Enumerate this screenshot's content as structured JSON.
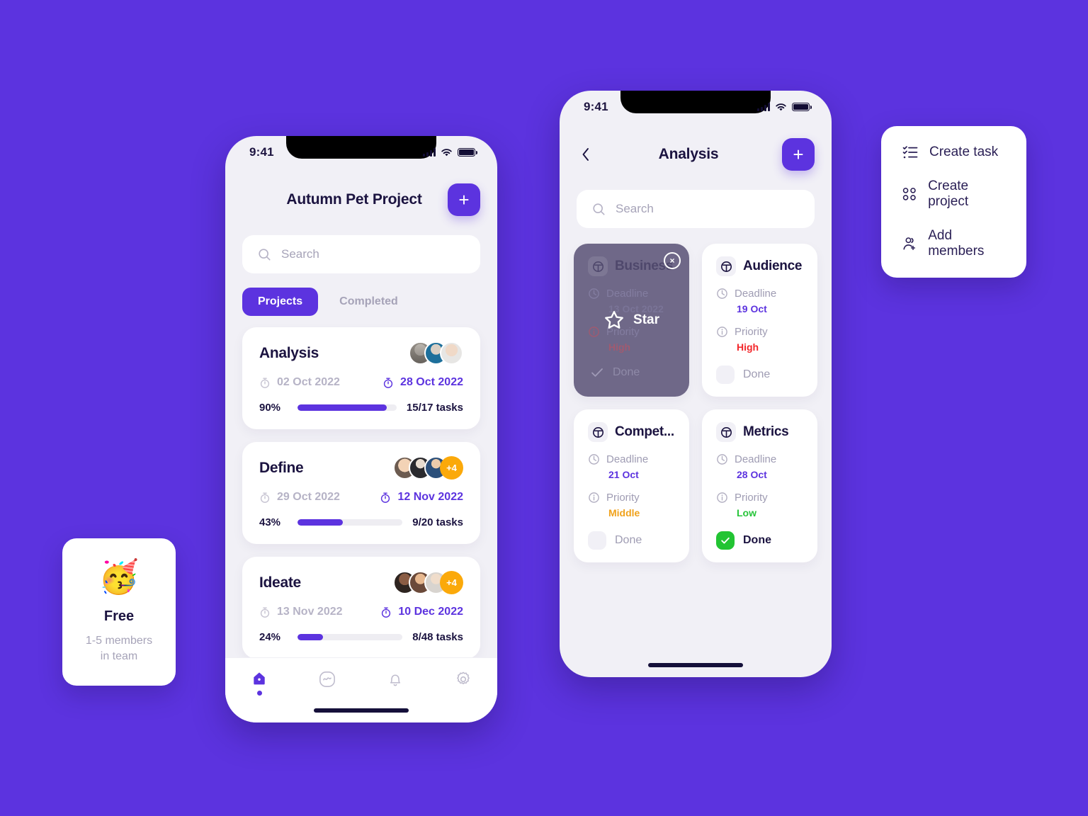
{
  "theme": {
    "background": "#5c33df",
    "accent": "#5c33df",
    "screen_bg": "#f1f0f6",
    "card_bg": "#ffffff",
    "orange": "#fba90a",
    "red": "#f3272b",
    "green": "#22c433",
    "text_dark": "#1b1340",
    "text_muted": "#a6a3b8"
  },
  "phone_projects": {
    "status_bar": {
      "time": "9:41",
      "signal_icon": "cellular-bars-icon",
      "wifi_icon": "wifi-icon",
      "battery_icon": "battery-full-icon"
    },
    "header": {
      "title": "Autumn Pet Project",
      "add_button_label": "+",
      "add_button_icon": "plus-icon"
    },
    "search": {
      "placeholder": "Search",
      "value": "",
      "icon": "search-icon"
    },
    "tabs": [
      {
        "label": "Projects",
        "active": true
      },
      {
        "label": "Completed",
        "active": false
      }
    ],
    "projects": [
      {
        "title": "Analysis",
        "start_date": "02 Oct 2022",
        "end_date": "28 Oct 2022",
        "percent_label": "90%",
        "percent": 90,
        "tasks_label": "15/17 tasks",
        "avatars": 3,
        "extra_members": null
      },
      {
        "title": "Define",
        "start_date": "29 Oct 2022",
        "end_date": "12 Nov 2022",
        "percent_label": "43%",
        "percent": 43,
        "tasks_label": "9/20 tasks",
        "avatars": 3,
        "extra_members": "+4"
      },
      {
        "title": "Ideate",
        "start_date": "13 Nov 2022",
        "end_date": "10 Dec 2022",
        "percent_label": "24%",
        "percent": 24,
        "tasks_label": "8/48 tasks",
        "avatars": 3,
        "extra_members": "+4"
      }
    ],
    "tabbar": [
      {
        "icon": "home-icon",
        "active": true
      },
      {
        "icon": "activity-icon",
        "active": false
      },
      {
        "icon": "bell-icon",
        "active": false
      },
      {
        "icon": "gear-icon",
        "active": false
      }
    ]
  },
  "phone_analysis": {
    "status_bar": {
      "time": "9:41",
      "signal_icon": "cellular-bars-icon",
      "wifi_icon": "wifi-icon",
      "battery_icon": "battery-full-icon"
    },
    "header": {
      "title": "Analysis",
      "back_icon": "chevron-left-icon",
      "add_button_label": "+",
      "add_button_icon": "plus-icon"
    },
    "search": {
      "placeholder": "Search",
      "value": "",
      "icon": "search-icon"
    },
    "labels": {
      "deadline": "Deadline",
      "priority": "Priority",
      "done": "Done"
    },
    "tasks": [
      {
        "title": "Business",
        "deadline": "13 Oct 2022",
        "priority": "High",
        "priority_level": "high",
        "done": false,
        "selected": true,
        "overlay": {
          "action_label": "Star",
          "action_icon": "star-icon",
          "close_icon": "close-icon"
        }
      },
      {
        "title": "Audience",
        "deadline": "19 Oct",
        "priority": "High",
        "priority_level": "high",
        "done": false,
        "selected": false
      },
      {
        "title": "Compet...",
        "deadline": "21 Oct",
        "priority": "Middle",
        "priority_level": "middle",
        "done": false,
        "selected": false
      },
      {
        "title": "Metrics",
        "deadline": "28 Oct",
        "priority": "Low",
        "priority_level": "low",
        "done": true,
        "selected": false
      }
    ]
  },
  "context_menu": {
    "items": [
      {
        "label": "Create task",
        "icon": "list-checks-icon"
      },
      {
        "label": "Create project",
        "icon": "grid-squares-icon"
      },
      {
        "label": "Add members",
        "icon": "user-plus-icon"
      }
    ]
  },
  "plan_card": {
    "emoji": "🥳",
    "emoji_name": "party-face-emoji",
    "title": "Free",
    "subtitle_line1": "1-5 members",
    "subtitle_line2": "in team"
  }
}
